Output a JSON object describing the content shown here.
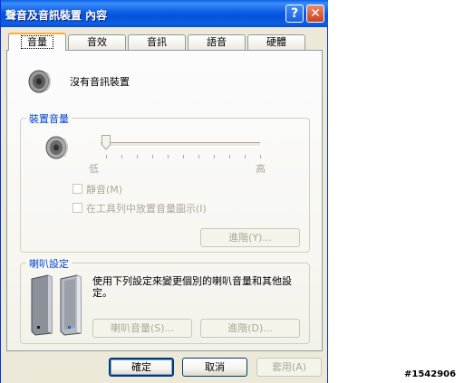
{
  "window": {
    "title": "聲音及音訊裝置 內容",
    "help_icon": "?",
    "close_icon": "✕"
  },
  "tabs": [
    {
      "label": "音量",
      "active": true
    },
    {
      "label": "音效",
      "active": false
    },
    {
      "label": "音訊",
      "active": false
    },
    {
      "label": "語音",
      "active": false
    },
    {
      "label": "硬體",
      "active": false
    }
  ],
  "volume_tab": {
    "device_status": "沒有音訊裝置",
    "device_volume": {
      "title": "裝置音量",
      "slider_level": 0,
      "low_label": "低",
      "high_label": "高",
      "mute_label": "靜音(M)",
      "taskbar_icon_label": "在工具列中放置音量圖示(I)",
      "advanced_button": "進階(Y)..."
    },
    "speaker_settings": {
      "title": "喇叭設定",
      "description": "使用下列設定來變更個別的喇叭音量和其他設定。",
      "speaker_volume_button": "喇叭音量(S)...",
      "advanced_button": "進階(D)..."
    }
  },
  "footer": {
    "ok": "確定",
    "cancel": "取消",
    "apply": "套用(A)"
  },
  "watermark": "#1542906"
}
